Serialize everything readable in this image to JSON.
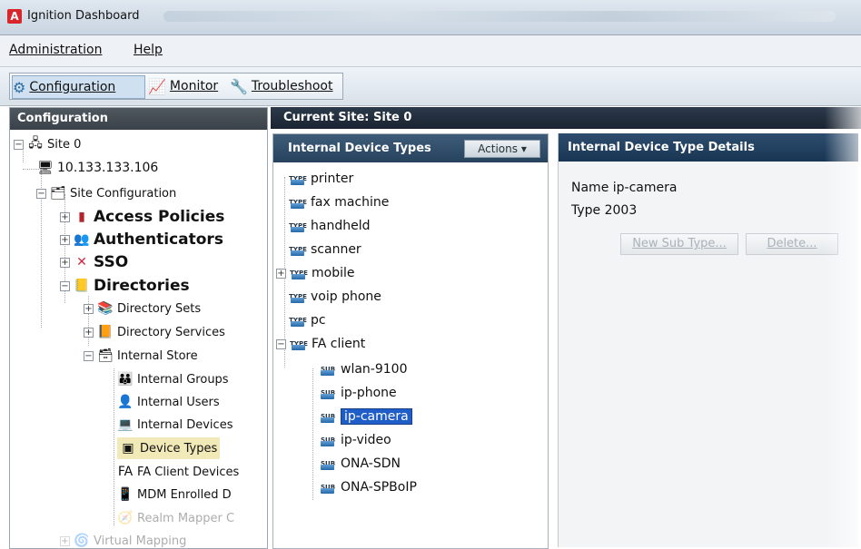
{
  "window": {
    "title": "Ignition Dashboard",
    "app_icon_text": "A"
  },
  "menu": {
    "items": [
      {
        "label": "Administration"
      },
      {
        "label": "Help"
      }
    ]
  },
  "toolbar": {
    "buttons": [
      {
        "label": "Configuration",
        "icon": "gear-icon",
        "active": true
      },
      {
        "label": "Monitor",
        "icon": "monitor-icon",
        "active": false
      },
      {
        "label": "Troubleshoot",
        "icon": "wrench-icon",
        "active": false
      }
    ]
  },
  "left_panel": {
    "header": "Configuration",
    "items": [
      {
        "label": "Site 0",
        "icon": "network-icon",
        "expander": "−"
      },
      {
        "label": "10.133.133.106",
        "icon": "server-icon"
      },
      {
        "label": "Site Configuration",
        "icon": "folder-gear-icon",
        "expander": "−"
      },
      {
        "label": "Access Policies",
        "icon": "policy-icon",
        "expander": "+"
      },
      {
        "label": "Authenticators",
        "icon": "authenticator-icon",
        "expander": "+"
      },
      {
        "label": "SSO",
        "icon": "sso-icon",
        "expander": "+"
      },
      {
        "label": "Directories",
        "icon": "directory-icon",
        "expander": "−"
      },
      {
        "label": "Directory Sets",
        "icon": "directory-sets-icon",
        "expander": "+"
      },
      {
        "label": "Directory Services",
        "icon": "directory-services-icon",
        "expander": "+"
      },
      {
        "label": "Internal Store",
        "icon": "internal-store-icon",
        "expander": "−"
      },
      {
        "label": "Internal Groups",
        "icon": "groups-icon"
      },
      {
        "label": "Internal Users",
        "icon": "user-icon"
      },
      {
        "label": "Internal Devices",
        "icon": "devices-icon"
      },
      {
        "label": "Device Types",
        "icon": "device-type-icon",
        "selected": true
      },
      {
        "label": "FA Client Devices",
        "icon": "fa-client-icon"
      },
      {
        "label": "MDM Enrolled D",
        "icon": "mdm-icon"
      },
      {
        "label": "Realm Mapper C",
        "icon": "realm-mapper-icon"
      },
      {
        "label": "Virtual Mapping",
        "icon": "virtual-mapping-icon",
        "faded": true
      }
    ]
  },
  "site_bar": {
    "text": "Current Site:  Site 0"
  },
  "device_types_panel": {
    "header": "Internal Device Types",
    "actions_label": "Actions",
    "icon_text_type": "TYPE",
    "icon_text_sub": "SUB",
    "items": [
      {
        "label": "printer",
        "level": 0
      },
      {
        "label": "fax machine",
        "level": 0
      },
      {
        "label": "handheld",
        "level": 0
      },
      {
        "label": "scanner",
        "level": 0
      },
      {
        "label": "mobile",
        "level": 0,
        "expander": "+"
      },
      {
        "label": "voip phone",
        "level": 0
      },
      {
        "label": "pc",
        "level": 0
      },
      {
        "label": "FA client",
        "level": 0,
        "expander": "−"
      },
      {
        "label": "wlan-9100",
        "level": 1
      },
      {
        "label": "ip-phone",
        "level": 1
      },
      {
        "label": "ip-camera",
        "level": 1,
        "selected": true
      },
      {
        "label": "ip-video",
        "level": 1
      },
      {
        "label": "ONA-SDN",
        "level": 1
      },
      {
        "label": "ONA-SPBoIP",
        "level": 1
      }
    ]
  },
  "details_panel": {
    "header": "Internal Device Type Details",
    "name_label": "Name",
    "name_value": "ip-camera",
    "type_label": "Type",
    "type_value": "2003",
    "new_sub_type_button": "New Sub Type...",
    "delete_button": "Delete..."
  }
}
